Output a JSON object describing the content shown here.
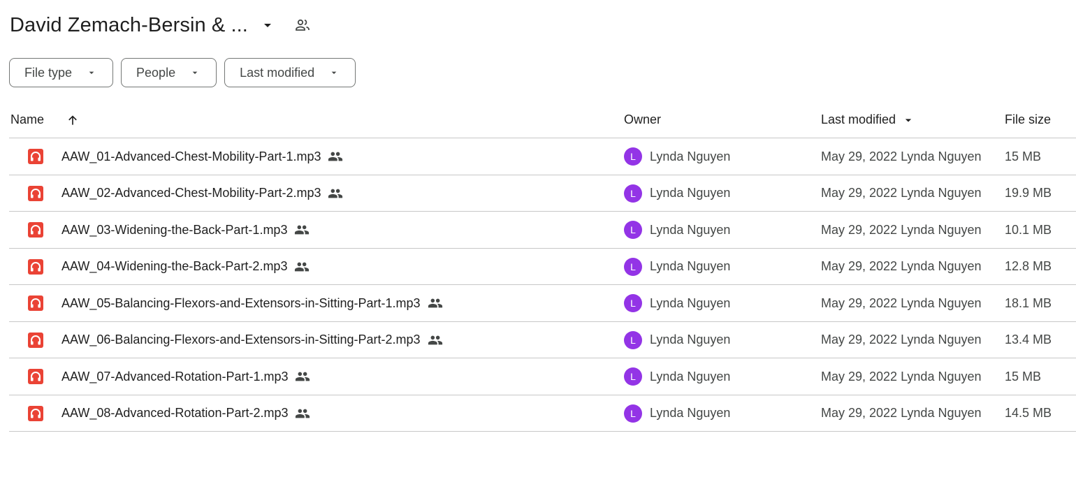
{
  "header": {
    "folder_title": "David Zemach-Bersin & ...",
    "dropdown_icon": "arrow-drop-down-icon",
    "shared_icon": "people-outline-icon"
  },
  "filters": [
    {
      "label": "File type"
    },
    {
      "label": "People"
    },
    {
      "label": "Last modified"
    }
  ],
  "table": {
    "columns": {
      "name": "Name",
      "owner": "Owner",
      "modified": "Last modified",
      "size": "File size"
    },
    "sort": {
      "column": "name",
      "direction": "ascending",
      "icon": "arrow-upward-icon"
    },
    "rows": [
      {
        "name": "AAW_01-Advanced-Chest-Mobility-Part-1.mp3",
        "owner": "Lynda Nguyen",
        "owner_initial": "L",
        "modified": "May 29, 2022 Lynda Nguyen",
        "size": "15 MB"
      },
      {
        "name": "AAW_02-Advanced-Chest-Mobility-Part-2.mp3",
        "owner": "Lynda Nguyen",
        "owner_initial": "L",
        "modified": "May 29, 2022 Lynda Nguyen",
        "size": "19.9 MB"
      },
      {
        "name": "AAW_03-Widening-the-Back-Part-1.mp3",
        "owner": "Lynda Nguyen",
        "owner_initial": "L",
        "modified": "May 29, 2022 Lynda Nguyen",
        "size": "10.1 MB"
      },
      {
        "name": "AAW_04-Widening-the-Back-Part-2.mp3",
        "owner": "Lynda Nguyen",
        "owner_initial": "L",
        "modified": "May 29, 2022 Lynda Nguyen",
        "size": "12.8 MB"
      },
      {
        "name": "AAW_05-Balancing-Flexors-and-Extensors-in-Sitting-Part-1.mp3",
        "owner": "Lynda Nguyen",
        "owner_initial": "L",
        "modified": "May 29, 2022 Lynda Nguyen",
        "size": "18.1 MB"
      },
      {
        "name": "AAW_06-Balancing-Flexors-and-Extensors-in-Sitting-Part-2.mp3",
        "owner": "Lynda Nguyen",
        "owner_initial": "L",
        "modified": "May 29, 2022 Lynda Nguyen",
        "size": "13.4 MB"
      },
      {
        "name": "AAW_07-Advanced-Rotation-Part-1.mp3",
        "owner": "Lynda Nguyen",
        "owner_initial": "L",
        "modified": "May 29, 2022 Lynda Nguyen",
        "size": "15 MB"
      },
      {
        "name": "AAW_08-Advanced-Rotation-Part-2.mp3",
        "owner": "Lynda Nguyen",
        "owner_initial": "L",
        "modified": "May 29, 2022 Lynda Nguyen",
        "size": "14.5 MB"
      }
    ]
  },
  "icons": {
    "file_icon": "audio-file-icon",
    "shared_icon": "people-icon"
  },
  "colors": {
    "audio_icon": "#ea4335",
    "avatar": "#9334e6",
    "divider": "#c7c7c7",
    "chip_border": "#747775"
  }
}
